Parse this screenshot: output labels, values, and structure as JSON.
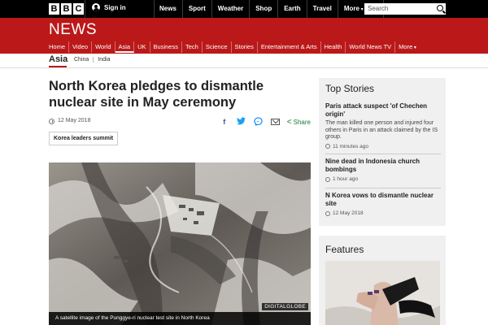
{
  "masthead": {
    "logo_letters": [
      "B",
      "B",
      "C"
    ],
    "signin_label": "Sign in",
    "nav": [
      "News",
      "Sport",
      "Weather",
      "Shop",
      "Earth",
      "Travel",
      "More"
    ],
    "search_placeholder": "Search"
  },
  "news_header": {
    "title": "NEWS",
    "nav": [
      "Home",
      "Video",
      "World",
      "Asia",
      "UK",
      "Business",
      "Tech",
      "Science",
      "Stories",
      "Entertainment & Arts",
      "Health",
      "World News TV",
      "More"
    ],
    "active_item": "Asia"
  },
  "section": {
    "title": "Asia",
    "links": [
      "China",
      "India"
    ]
  },
  "article": {
    "headline": "North Korea pledges to dismantle nuclear site in May ceremony",
    "date": "12 May 2018",
    "share_label": "Share",
    "tag": "Korea leaders summit",
    "image_credit": "DIGITALGLOBE",
    "image_caption": "A satellite image of the Punggye-ri nuclear test site in North Korea"
  },
  "sidebar": {
    "top_stories_title": "Top Stories",
    "stories": [
      {
        "headline": "Paris attack suspect 'of Chechen origin'",
        "summary": "The man killed one person and injured four others in Paris in an attack claimed by the IS group.",
        "time": "11 minutes ago"
      },
      {
        "headline": "Nine dead in Indonesia church bombings",
        "time": "1 hour ago"
      },
      {
        "headline": "N Korea vows to dismantle nuclear site",
        "time": "12 May 2018"
      }
    ],
    "features_title": "Features"
  },
  "colors": {
    "brand_red": "#bb1919",
    "masthead_black": "#000000",
    "sidebar_bg": "#f0f0f0",
    "share_green": "#1a7a3a"
  }
}
